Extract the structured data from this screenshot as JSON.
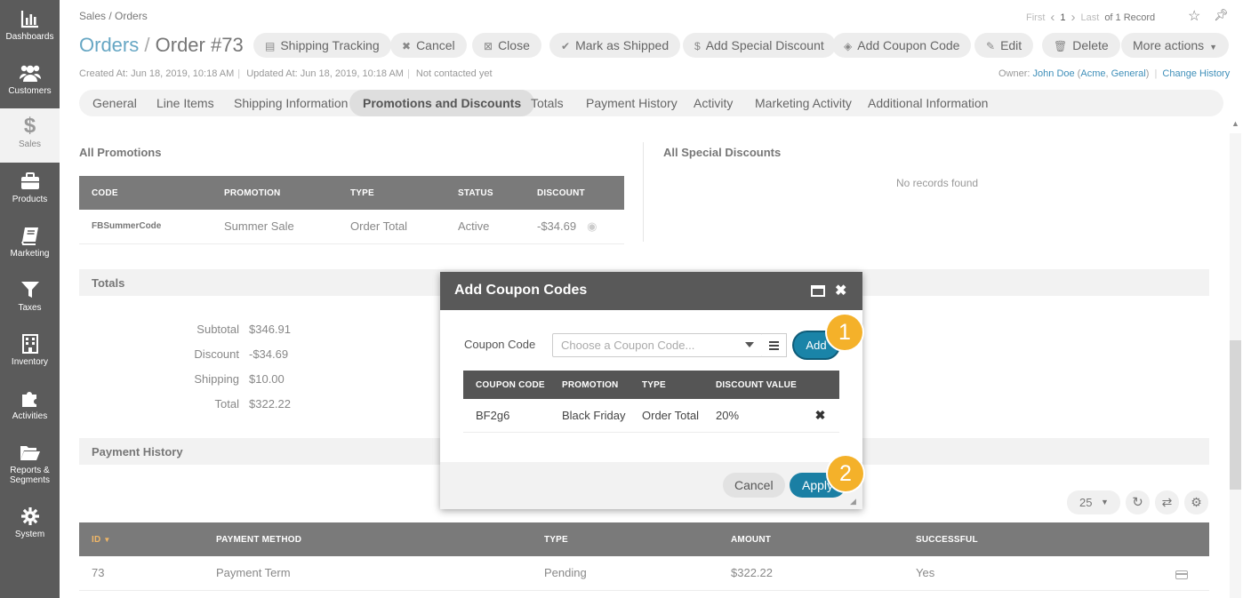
{
  "sidebar": {
    "items": [
      {
        "label": "Dashboards",
        "icon": "bar-chart-icon"
      },
      {
        "label": "Customers",
        "icon": "users-icon"
      },
      {
        "label": "Sales",
        "icon": "dollar-icon"
      },
      {
        "label": "Products",
        "icon": "briefcase-icon"
      },
      {
        "label": "Marketing",
        "icon": "book-icon"
      },
      {
        "label": "Taxes",
        "icon": "funnel-icon"
      },
      {
        "label": "Inventory",
        "icon": "building-icon"
      },
      {
        "label": "Activities",
        "icon": "puzzle-icon"
      },
      {
        "label": "Reports &",
        "label2": "Segments",
        "icon": "folder-icon"
      },
      {
        "label": "System",
        "icon": "gear-icon"
      }
    ]
  },
  "header": {
    "breadcrumb": "Sales / Orders",
    "pager": {
      "first": "First",
      "page": "1",
      "last": "Last",
      "total": "of 1 Record"
    },
    "title_entity": "Orders",
    "title_sep": "/",
    "title_record": "Order #73",
    "actions": [
      {
        "label": "Shipping Tracking",
        "icon": "tracking-icon"
      },
      {
        "label": "Cancel",
        "icon": "x-icon"
      },
      {
        "label": "Close",
        "icon": "close-box-icon"
      },
      {
        "label": "Mark as Shipped",
        "icon": "check-icon"
      },
      {
        "label": "Add Special Discount",
        "icon": "dollar-icon"
      },
      {
        "label": "Add Coupon Code",
        "icon": "tag-icon"
      },
      {
        "label": "Edit",
        "icon": "edit-icon"
      },
      {
        "label": "Delete",
        "icon": "trash-icon"
      },
      {
        "label": "More actions",
        "icon": "caret-down-icon"
      }
    ],
    "created": "Created At: Jun 18, 2019, 10:18 AM",
    "updated": "Updated At: Jun 18, 2019, 10:18 AM",
    "contacted": "Not contacted yet",
    "owner_label": "Owner:",
    "owner_name": "John Doe",
    "owner_org1": "Acme",
    "owner_org2": "General",
    "change_history": "Change History"
  },
  "tabs": [
    "General",
    "Line Items",
    "Shipping Information",
    "Promotions and Discounts",
    "Totals",
    "Payment History",
    "Activity",
    "Marketing Activity",
    "Additional Information"
  ],
  "active_tab": "Promotions and Discounts",
  "promotions": {
    "title": "All Promotions",
    "columns": [
      "CODE",
      "PROMOTION",
      "TYPE",
      "STATUS",
      "DISCOUNT"
    ],
    "rows": [
      {
        "code": "FBSummerCode",
        "promotion": "Summer Sale",
        "type": "Order Total",
        "status": "Active",
        "discount": "-$34.69"
      }
    ]
  },
  "special_discounts": {
    "title": "All Special Discounts",
    "empty": "No records found"
  },
  "totals": {
    "title": "Totals",
    "rows": [
      {
        "label": "Subtotal",
        "value": "$346.91"
      },
      {
        "label": "Discount",
        "value": "-$34.69"
      },
      {
        "label": "Shipping",
        "value": "$10.00"
      },
      {
        "label": "Total",
        "value": "$322.22"
      }
    ]
  },
  "payment_history": {
    "title": "Payment History",
    "page_size": "25",
    "columns": [
      "ID",
      "PAYMENT METHOD",
      "TYPE",
      "AMOUNT",
      "SUCCESSFUL"
    ],
    "rows": [
      {
        "id": "73",
        "method": "Payment Term",
        "type": "Pending",
        "amount": "$322.22",
        "successful": "Yes"
      }
    ]
  },
  "dialog": {
    "title": "Add Coupon Codes",
    "field_label": "Coupon Code",
    "placeholder": "Choose a Coupon Code...",
    "add_label": "Add",
    "columns": [
      "COUPON CODE",
      "PROMOTION",
      "TYPE",
      "DISCOUNT VALUE"
    ],
    "rows": [
      {
        "code": "BF2g6",
        "promotion": "Black Friday",
        "type": "Order Total",
        "value": "20%"
      }
    ],
    "cancel_label": "Cancel",
    "apply_label": "Apply"
  },
  "steps": [
    "1",
    "2"
  ],
  "colors": {
    "accent": "#1a84a8",
    "step_badge": "#f4b12a",
    "sidebar_bg": "#5b5b5b",
    "title_blue": "#67a7c4"
  }
}
